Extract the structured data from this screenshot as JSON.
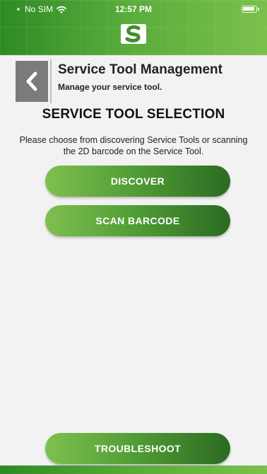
{
  "status_bar": {
    "carrier": "No SIM",
    "time": "12:57 PM"
  },
  "header": {
    "title": "Service Tool Management",
    "subtitle": "Manage your service tool."
  },
  "section": {
    "title": "SERVICE TOOL SELECTION",
    "instructions": "Please choose from discovering Service Tools or scanning the 2D barcode on the Service Tool."
  },
  "buttons": {
    "discover": "DISCOVER",
    "scan_barcode": "SCAN BARCODE",
    "troubleshoot": "TROUBLESHOOT"
  },
  "colors": {
    "brand_green": "#4f9b34",
    "header_green_light": "#7cc04c",
    "header_green_dark": "#2e8a24",
    "back_button_gray": "#7b7b7b",
    "background": "#f2f2f2"
  },
  "icons": {
    "wifi": "wifi-icon",
    "battery": "battery-icon",
    "logo": "brand-logo-icon",
    "back": "chevron-left-icon"
  }
}
